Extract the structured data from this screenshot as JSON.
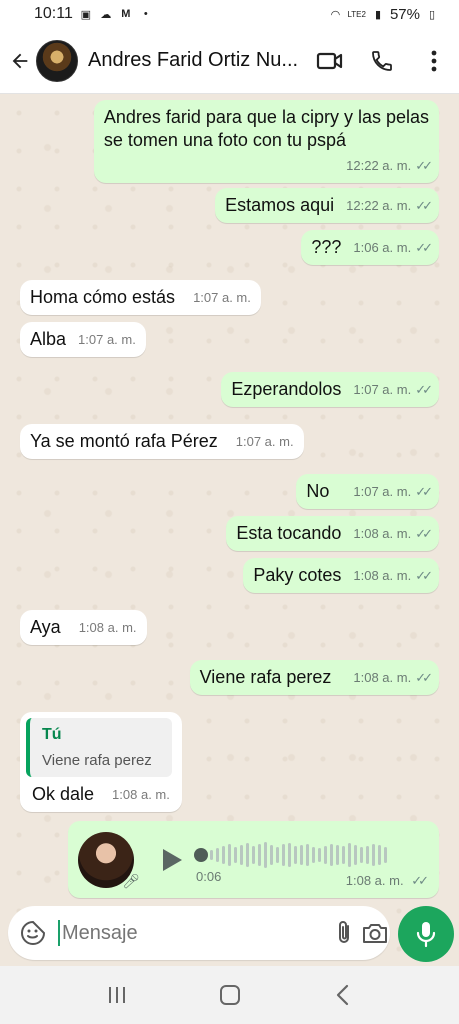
{
  "status": {
    "time": "10:11",
    "battery": "57%",
    "net_label": "LTE2"
  },
  "header": {
    "title": "Andres Farid Ortiz Nu..."
  },
  "messages": [
    {
      "side": "out",
      "lines": [
        "Andres farid para que la cipry y las pelas",
        "se tomen una foto con tu pspá"
      ],
      "time": "12:22 a. m."
    },
    {
      "side": "out",
      "text": "Estamos aqui",
      "time": "12:22 a. m."
    },
    {
      "side": "out",
      "text": "???",
      "time": "1:06 a. m."
    },
    {
      "side": "in",
      "text": "Homa cómo estás",
      "time": "1:07 a. m."
    },
    {
      "side": "in",
      "text": "Alba",
      "time": "1:07 a. m."
    },
    {
      "side": "out",
      "text": "Ezperandolos",
      "time": "1:07 a. m."
    },
    {
      "side": "in",
      "text": "Ya  se montó rafa Pérez",
      "time": "1:07 a. m."
    },
    {
      "side": "out",
      "text": "No",
      "time": "1:07 a. m."
    },
    {
      "side": "out",
      "text": "Esta tocando",
      "time": "1:08 a. m."
    },
    {
      "side": "out",
      "text": "Paky cotes",
      "time": "1:08 a. m."
    },
    {
      "side": "in",
      "text": "Aya",
      "time": "1:08 a. m."
    },
    {
      "side": "out",
      "text": "Viene rafa perez",
      "time": "1:08 a. m."
    },
    {
      "side": "in",
      "text": "Ok dale",
      "time": "1:08 a. m.",
      "quote": {
        "author": "Tú",
        "text": "Viene rafa perez"
      }
    }
  ],
  "audio": {
    "duration": "0:06",
    "time": "1:08 a. m.",
    "progress": 0
  },
  "composer": {
    "placeholder": "Mensaje"
  },
  "colors": {
    "outgoing": "#d9fdd3",
    "incoming": "#ffffff",
    "accent": "#1ca65d"
  },
  "icons": [
    "back-arrow-icon",
    "video-call-icon",
    "phone-icon",
    "more-vert-icon",
    "sticker-icon",
    "attach-icon",
    "camera-icon",
    "mic-icon",
    "play-icon",
    "nav-recents-icon",
    "nav-home-icon",
    "nav-back-icon"
  ]
}
